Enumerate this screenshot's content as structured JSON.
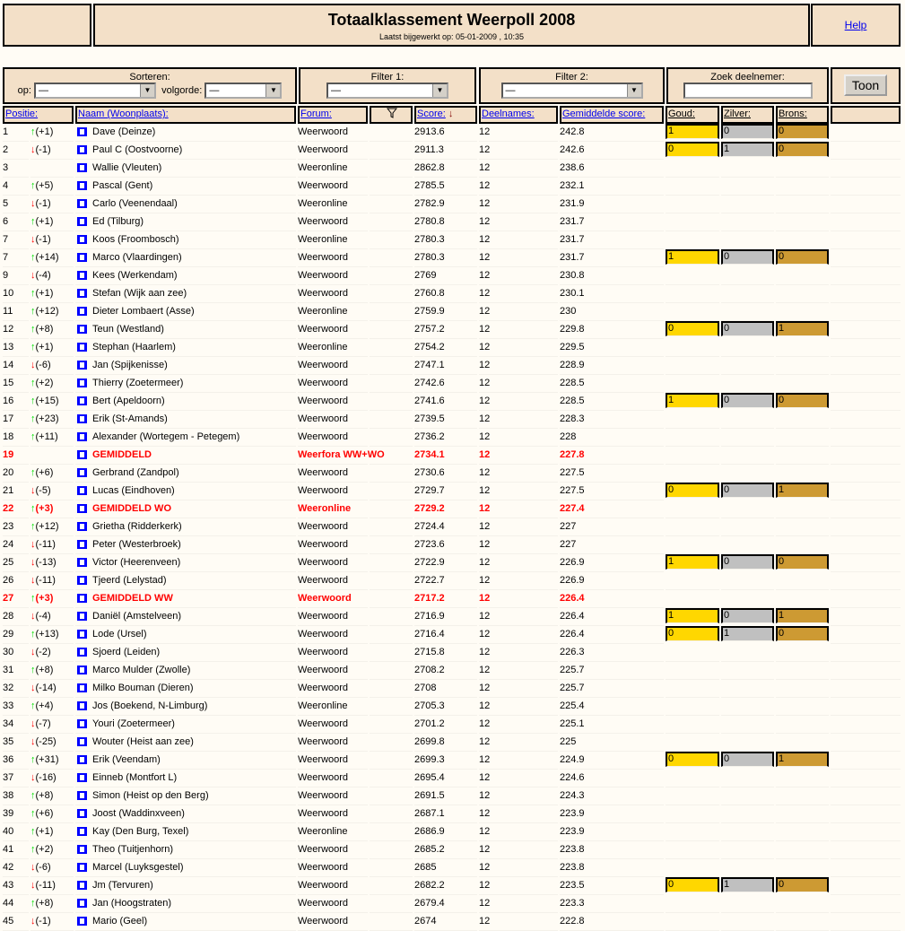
{
  "header": {
    "title": "Totaalklassement Weerpoll 2008",
    "updated": "Laatst bijgewerkt op: 05-01-2009 , 10:35",
    "help": "Help"
  },
  "controls": {
    "sort_label": "Sorteren:",
    "op_label": "op:",
    "op_value": "—",
    "order_label": "volgorde:",
    "order_value": "—",
    "filter1_label": "Filter 1:",
    "filter1_value": "—",
    "filter2_label": "Filter 2:",
    "filter2_value": "—",
    "search_label": "Zoek deelnemer:",
    "search_value": "",
    "show_button": "Toon"
  },
  "columns": {
    "position": "Positie:",
    "name": "Naam (Woonplaats):",
    "forum": "Forum:",
    "score": "Score:",
    "entries": "Deelnames:",
    "avg": "Gemiddelde score:",
    "gold": "Goud:",
    "silver": "Zilver:",
    "bronze": "Brons:"
  },
  "colors": {
    "gold": "#ffd700",
    "silver": "#c0c0c0",
    "bronze": "#cd9a33",
    "header_bg": "#f3e0c8",
    "highlight": "#ff0000"
  },
  "rows": [
    {
      "pos": "1",
      "dir": "up",
      "chg": "(+1)",
      "name": "Dave (Deinze)",
      "forum": "Weerwoord",
      "score": "2913.6",
      "n": "12",
      "avg": "242.8",
      "medals": [
        "1",
        "0",
        "0"
      ]
    },
    {
      "pos": "2",
      "dir": "down",
      "chg": "(-1)",
      "name": "Paul C (Oostvoorne)",
      "forum": "Weerwoord",
      "score": "2911.3",
      "n": "12",
      "avg": "242.6",
      "medals": [
        "0",
        "1",
        "0"
      ]
    },
    {
      "pos": "3",
      "dir": "",
      "chg": "",
      "name": "Wallie (Vleuten)",
      "forum": "Weeronline",
      "score": "2862.8",
      "n": "12",
      "avg": "238.6"
    },
    {
      "pos": "4",
      "dir": "up",
      "chg": "(+5)",
      "name": "Pascal (Gent)",
      "forum": "Weerwoord",
      "score": "2785.5",
      "n": "12",
      "avg": "232.1"
    },
    {
      "pos": "5",
      "dir": "down",
      "chg": "(-1)",
      "name": "Carlo (Veenendaal)",
      "forum": "Weeronline",
      "score": "2782.9",
      "n": "12",
      "avg": "231.9"
    },
    {
      "pos": "6",
      "dir": "up",
      "chg": "(+1)",
      "name": "Ed (Tilburg)",
      "forum": "Weerwoord",
      "score": "2780.8",
      "n": "12",
      "avg": "231.7"
    },
    {
      "pos": "7",
      "dir": "down",
      "chg": "(-1)",
      "name": "Koos (Froombosch)",
      "forum": "Weeronline",
      "score": "2780.3",
      "n": "12",
      "avg": "231.7"
    },
    {
      "pos": "7",
      "dir": "up",
      "chg": "(+14)",
      "name": "Marco (Vlaardingen)",
      "forum": "Weerwoord",
      "score": "2780.3",
      "n": "12",
      "avg": "231.7",
      "medals": [
        "1",
        "0",
        "0"
      ]
    },
    {
      "pos": "9",
      "dir": "down",
      "chg": "(-4)",
      "name": "Kees (Werkendam)",
      "forum": "Weerwoord",
      "score": "2769",
      "n": "12",
      "avg": "230.8"
    },
    {
      "pos": "10",
      "dir": "up",
      "chg": "(+1)",
      "name": "Stefan (Wijk aan zee)",
      "forum": "Weerwoord",
      "score": "2760.8",
      "n": "12",
      "avg": "230.1"
    },
    {
      "pos": "11",
      "dir": "up",
      "chg": "(+12)",
      "name": "Dieter Lombaert (Asse)",
      "forum": "Weeronline",
      "score": "2759.9",
      "n": "12",
      "avg": "230"
    },
    {
      "pos": "12",
      "dir": "up",
      "chg": "(+8)",
      "name": "Teun (Westland)",
      "forum": "Weerwoord",
      "score": "2757.2",
      "n": "12",
      "avg": "229.8",
      "medals": [
        "0",
        "0",
        "1"
      ]
    },
    {
      "pos": "13",
      "dir": "up",
      "chg": "(+1)",
      "name": "Stephan (Haarlem)",
      "forum": "Weeronline",
      "score": "2754.2",
      "n": "12",
      "avg": "229.5"
    },
    {
      "pos": "14",
      "dir": "down",
      "chg": "(-6)",
      "name": "Jan (Spijkenisse)",
      "forum": "Weerwoord",
      "score": "2747.1",
      "n": "12",
      "avg": "228.9"
    },
    {
      "pos": "15",
      "dir": "up",
      "chg": "(+2)",
      "name": "Thierry (Zoetermeer)",
      "forum": "Weerwoord",
      "score": "2742.6",
      "n": "12",
      "avg": "228.5"
    },
    {
      "pos": "16",
      "dir": "up",
      "chg": "(+15)",
      "name": "Bert (Apeldoorn)",
      "forum": "Weerwoord",
      "score": "2741.6",
      "n": "12",
      "avg": "228.5",
      "medals": [
        "1",
        "0",
        "0"
      ]
    },
    {
      "pos": "17",
      "dir": "up",
      "chg": "(+23)",
      "name": "Erik (St-Amands)",
      "forum": "Weerwoord",
      "score": "2739.5",
      "n": "12",
      "avg": "228.3"
    },
    {
      "pos": "18",
      "dir": "up",
      "chg": "(+11)",
      "name": "Alexander (Wortegem - Petegem)",
      "forum": "Weerwoord",
      "score": "2736.2",
      "n": "12",
      "avg": "228"
    },
    {
      "pos": "19",
      "dir": "",
      "chg": "",
      "name": "GEMIDDELD",
      "forum": "Weerfora WW+WO",
      "score": "2734.1",
      "n": "12",
      "avg": "227.8",
      "hl": true
    },
    {
      "pos": "20",
      "dir": "up",
      "chg": "(+6)",
      "name": "Gerbrand (Zandpol)",
      "forum": "Weerwoord",
      "score": "2730.6",
      "n": "12",
      "avg": "227.5"
    },
    {
      "pos": "21",
      "dir": "down",
      "chg": "(-5)",
      "name": "Lucas (Eindhoven)",
      "forum": "Weerwoord",
      "score": "2729.7",
      "n": "12",
      "avg": "227.5",
      "medals": [
        "0",
        "0",
        "1"
      ]
    },
    {
      "pos": "22",
      "dir": "up",
      "chg": "(+3)",
      "name": "GEMIDDELD WO",
      "forum": "Weeronline",
      "score": "2729.2",
      "n": "12",
      "avg": "227.4",
      "hl": true
    },
    {
      "pos": "23",
      "dir": "up",
      "chg": "(+12)",
      "name": "Grietha (Ridderkerk)",
      "forum": "Weerwoord",
      "score": "2724.4",
      "n": "12",
      "avg": "227"
    },
    {
      "pos": "24",
      "dir": "down",
      "chg": "(-11)",
      "name": "Peter (Westerbroek)",
      "forum": "Weerwoord",
      "score": "2723.6",
      "n": "12",
      "avg": "227"
    },
    {
      "pos": "25",
      "dir": "down",
      "chg": "(-13)",
      "name": "Victor (Heerenveen)",
      "forum": "Weerwoord",
      "score": "2722.9",
      "n": "12",
      "avg": "226.9",
      "medals": [
        "1",
        "0",
        "0"
      ]
    },
    {
      "pos": "26",
      "dir": "down",
      "chg": "(-11)",
      "name": "Tjeerd (Lelystad)",
      "forum": "Weerwoord",
      "score": "2722.7",
      "n": "12",
      "avg": "226.9"
    },
    {
      "pos": "27",
      "dir": "up",
      "chg": "(+3)",
      "name": "GEMIDDELD WW",
      "forum": "Weerwoord",
      "score": "2717.2",
      "n": "12",
      "avg": "226.4",
      "hl": true
    },
    {
      "pos": "28",
      "dir": "down",
      "chg": "(-4)",
      "name": "Daniël (Amstelveen)",
      "forum": "Weerwoord",
      "score": "2716.9",
      "n": "12",
      "avg": "226.4",
      "medals": [
        "1",
        "0",
        "1"
      ]
    },
    {
      "pos": "29",
      "dir": "up",
      "chg": "(+13)",
      "name": "Lode (Ursel)",
      "forum": "Weerwoord",
      "score": "2716.4",
      "n": "12",
      "avg": "226.4",
      "medals": [
        "0",
        "1",
        "0"
      ]
    },
    {
      "pos": "30",
      "dir": "down",
      "chg": "(-2)",
      "name": "Sjoerd (Leiden)",
      "forum": "Weerwoord",
      "score": "2715.8",
      "n": "12",
      "avg": "226.3"
    },
    {
      "pos": "31",
      "dir": "up",
      "chg": "(+8)",
      "name": "Marco Mulder (Zwolle)",
      "forum": "Weerwoord",
      "score": "2708.2",
      "n": "12",
      "avg": "225.7"
    },
    {
      "pos": "32",
      "dir": "down",
      "chg": "(-14)",
      "name": "Milko Bouman (Dieren)",
      "forum": "Weerwoord",
      "score": "2708",
      "n": "12",
      "avg": "225.7"
    },
    {
      "pos": "33",
      "dir": "up",
      "chg": "(+4)",
      "name": "Jos (Boekend, N-Limburg)",
      "forum": "Weeronline",
      "score": "2705.3",
      "n": "12",
      "avg": "225.4"
    },
    {
      "pos": "34",
      "dir": "down",
      "chg": "(-7)",
      "name": "Youri (Zoetermeer)",
      "forum": "Weerwoord",
      "score": "2701.2",
      "n": "12",
      "avg": "225.1"
    },
    {
      "pos": "35",
      "dir": "down",
      "chg": "(-25)",
      "name": "Wouter (Heist aan zee)",
      "forum": "Weerwoord",
      "score": "2699.8",
      "n": "12",
      "avg": "225"
    },
    {
      "pos": "36",
      "dir": "up",
      "chg": "(+31)",
      "name": "Erik (Veendam)",
      "forum": "Weerwoord",
      "score": "2699.3",
      "n": "12",
      "avg": "224.9",
      "medals": [
        "0",
        "0",
        "1"
      ]
    },
    {
      "pos": "37",
      "dir": "down",
      "chg": "(-16)",
      "name": "Einneb (Montfort L)",
      "forum": "Weerwoord",
      "score": "2695.4",
      "n": "12",
      "avg": "224.6"
    },
    {
      "pos": "38",
      "dir": "up",
      "chg": "(+8)",
      "name": "Simon (Heist op den Berg)",
      "forum": "Weerwoord",
      "score": "2691.5",
      "n": "12",
      "avg": "224.3"
    },
    {
      "pos": "39",
      "dir": "up",
      "chg": "(+6)",
      "name": "Joost (Waddinxveen)",
      "forum": "Weerwoord",
      "score": "2687.1",
      "n": "12",
      "avg": "223.9"
    },
    {
      "pos": "40",
      "dir": "up",
      "chg": "(+1)",
      "name": "Kay (Den Burg, Texel)",
      "forum": "Weeronline",
      "score": "2686.9",
      "n": "12",
      "avg": "223.9"
    },
    {
      "pos": "41",
      "dir": "up",
      "chg": "(+2)",
      "name": "Theo (Tuitjenhorn)",
      "forum": "Weerwoord",
      "score": "2685.2",
      "n": "12",
      "avg": "223.8"
    },
    {
      "pos": "42",
      "dir": "down",
      "chg": "(-6)",
      "name": "Marcel (Luyksgestel)",
      "forum": "Weerwoord",
      "score": "2685",
      "n": "12",
      "avg": "223.8"
    },
    {
      "pos": "43",
      "dir": "down",
      "chg": "(-11)",
      "name": "Jm (Tervuren)",
      "forum": "Weerwoord",
      "score": "2682.2",
      "n": "12",
      "avg": "223.5",
      "medals": [
        "0",
        "1",
        "0"
      ]
    },
    {
      "pos": "44",
      "dir": "up",
      "chg": "(+8)",
      "name": "Jan (Hoogstraten)",
      "forum": "Weerwoord",
      "score": "2679.4",
      "n": "12",
      "avg": "223.3"
    },
    {
      "pos": "45",
      "dir": "down",
      "chg": "(-1)",
      "name": "Mario (Geel)",
      "forum": "Weerwoord",
      "score": "2674",
      "n": "12",
      "avg": "222.8"
    }
  ]
}
